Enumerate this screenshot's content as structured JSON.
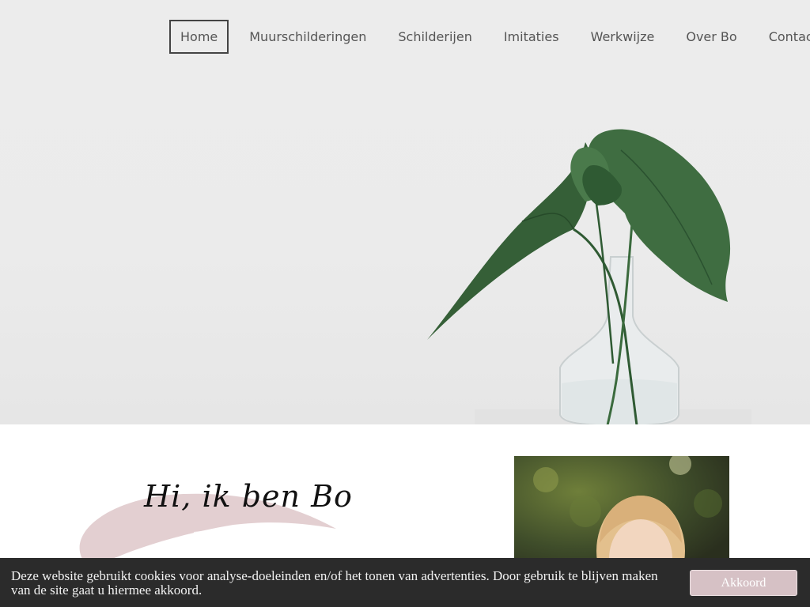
{
  "nav": {
    "items": [
      {
        "label": "Home",
        "active": true
      },
      {
        "label": "Muurschilderingen"
      },
      {
        "label": "Schilderijen"
      },
      {
        "label": "Imitaties"
      },
      {
        "label": "Werkwijze"
      },
      {
        "label": "Over Bo"
      },
      {
        "label": "Contact"
      }
    ]
  },
  "intro": {
    "title": "Hi, ik ben Bo"
  },
  "cookie": {
    "text": "Deze website gebruikt cookies voor analyse-doeleinden en/of het tonen van advertenties. Door gebruik te blijven maken van de site gaat u hiermee akkoord.",
    "button_label": "Akkoord"
  },
  "colors": {
    "accent": "#d6c1c5",
    "brush": "#e3cfd1",
    "cookie_bg": "#2b2b2b"
  },
  "icons": {
    "hero_image": "plant-in-vase-image",
    "portrait_image": "portrait-photo"
  }
}
